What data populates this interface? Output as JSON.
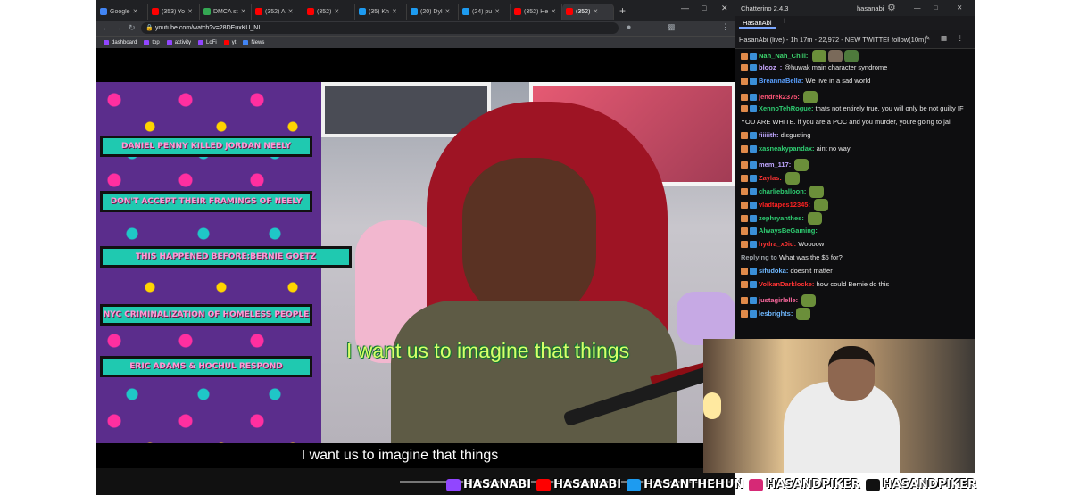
{
  "browser": {
    "tabs": [
      {
        "label": "Google",
        "color": "#4285f4"
      },
      {
        "label": "(353) Yo",
        "color": "#ff0000"
      },
      {
        "label": "DMCA st",
        "color": "#34a853"
      },
      {
        "label": "(352) A",
        "color": "#ff0000"
      },
      {
        "label": "(352)",
        "color": "#ff0000"
      },
      {
        "label": "(35) Kh",
        "color": "#1d9bf0"
      },
      {
        "label": "(20) Dyl",
        "color": "#1d9bf0"
      },
      {
        "label": "(24) pu",
        "color": "#1d9bf0"
      },
      {
        "label": "(352) He",
        "color": "#ff0000"
      },
      {
        "label": "(352)",
        "color": "#ff0000",
        "active": true
      }
    ],
    "new_tab": "+",
    "url": "youtube.com/watch?v=28DEuxKU_NI",
    "bookmarks": [
      "dashboard",
      "top",
      "activity",
      "LoFi",
      "yt",
      "News"
    ]
  },
  "video": {
    "pills": [
      "DANIEL PENNY KILLED JORDAN NEELY",
      "DON'T ACCEPT THEIR FRAMINGS OF NEELY",
      "THIS HAPPENED BEFORE:BERNIE GOETZ",
      "NYC CRIMINALIZATION OF HOMELESS PEOPLE",
      "ERIC ADAMS & HOCHUL RESPOND"
    ],
    "burned_subtitle": "I want us to imagine that things",
    "closed_caption": "I want us to imagine that things"
  },
  "chat": {
    "app_title": "Chatterino 2.4.3",
    "account": "hasanabi",
    "tab": "HasanAbi",
    "stream_info": "HasanAbi (live) - 1h 17m - 22,972 - NEW TWITTER CEO",
    "follow_mode": "follow(10m)",
    "messages": [
      {
        "user": "Nah_Nah_Chill:",
        "color": "#3cd06c",
        "text": "",
        "emotes": 3
      },
      {
        "user": "blooz_:",
        "color": "#c9a7ff",
        "text": "@huwak main character syndrome",
        "mention": "@huwak"
      },
      {
        "user": "BreannaBella:",
        "color": "#5aa0ff",
        "text": "We live in a sad world"
      },
      {
        "user": "jendrek2375:",
        "color": "#ff5577",
        "text": "",
        "emotes": 1
      },
      {
        "user": "XennoTehRogue:",
        "color": "#2ecc71",
        "text": "thats not entirely true. you will only be not guilty IF"
      },
      {
        "user": "",
        "color": "#ffffff",
        "text": "YOU ARE WHITE. if you are a POC and you murder, youre going to jail"
      },
      {
        "user": "fiiiiith:",
        "color": "#bfa6ff",
        "text": "disgusting"
      },
      {
        "user": "xasneakypandax:",
        "color": "#2ecc71",
        "text": "aint no way"
      },
      {
        "user": "mem_117:",
        "color": "#bfa6ff",
        "text": "",
        "emotes": 1
      },
      {
        "user": "Zaylas:",
        "color": "#ff3333",
        "text": "",
        "emotes": 1
      },
      {
        "user": "charlieballoon:",
        "color": "#2ecc71",
        "text": "",
        "emotes": 1
      },
      {
        "user": "vladtapes12345:",
        "color": "#ff2222",
        "text": "",
        "emotes": 1
      },
      {
        "user": "zephryanthes:",
        "color": "#2ecc71",
        "text": "",
        "emotes": 1
      },
      {
        "user": "AlwaysBeGaming:",
        "color": "#2ecc71",
        "text": ""
      },
      {
        "user": "hydra_x0id:",
        "color": "#ff3333",
        "text": "Woooow"
      },
      {
        "user": "Replying to",
        "color": "#9aa0a6",
        "text": "What was the $5 for?"
      },
      {
        "user": "sifudoka:",
        "color": "#6fb8ff",
        "text": "doesn't matter"
      },
      {
        "user": "VolkanDarklocke:",
        "color": "#ff3333",
        "text": "how could Bernie do this"
      },
      {
        "user": "justagirlelle:",
        "color": "#ff6aa0",
        "text": "",
        "emotes": 1
      },
      {
        "user": "lesbrights:",
        "color": "#6fb8ff",
        "text": "",
        "emotes": 1
      }
    ]
  },
  "overlay": {
    "socials": [
      {
        "handle": "HASANABI",
        "icon": "twitch-icon",
        "color": "#9146ff"
      },
      {
        "handle": "HASANABI",
        "icon": "youtube-icon",
        "color": "#ff0000"
      },
      {
        "handle": "HASANTHEHUN",
        "icon": "twitter-icon",
        "color": "#1d9bf0"
      },
      {
        "handle": "HASANDPIKER",
        "icon": "instagram-icon",
        "color": "#d62976"
      },
      {
        "handle": "HASANDPIKER",
        "icon": "tiktok-icon",
        "color": "#111111"
      }
    ]
  }
}
